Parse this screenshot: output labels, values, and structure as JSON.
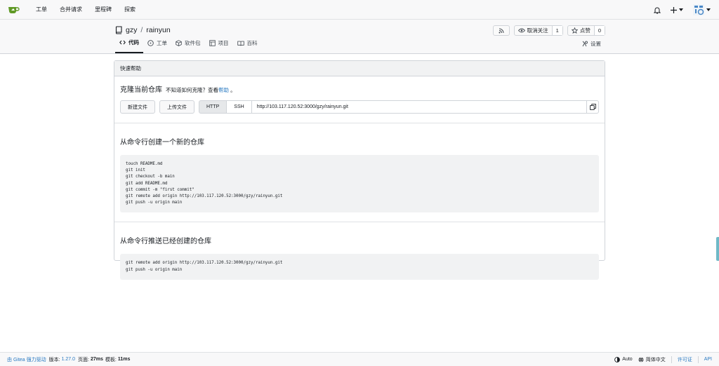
{
  "nav": {
    "links": [
      "工单",
      "合并请求",
      "里程碑",
      "探索"
    ]
  },
  "repo": {
    "owner": "gzy",
    "separator": "/",
    "name": "rainyun",
    "watch_label": "取消关注",
    "watch_count": "1",
    "star_label": "点赞",
    "star_count": "0",
    "tabs": [
      "代码",
      "工单",
      "软件包",
      "项目",
      "百科"
    ],
    "settings_label": "设置"
  },
  "panel": {
    "header": "快速帮助",
    "clone_title": "克隆当前仓库",
    "clone_hint": "不知道如何克隆？查看",
    "clone_help_link": "帮助",
    "clone_hint_end": "。",
    "new_file_button": "新建文件",
    "upload_file_button": "上传文件",
    "http_label": "HTTP",
    "ssh_label": "SSH",
    "clone_url": "http://103.117.120.52:3000/gzy/rainyun.git",
    "create_title": "从命令行创建一个新的仓库",
    "create_code": "touch README.md\ngit init\ngit checkout -b main\ngit add README.md\ngit commit -m \"first commit\"\ngit remote add origin http://103.117.120.52:3000/gzy/rainyun.git\ngit push -u origin main",
    "push_title": "从命令行推送已经创建的仓库",
    "push_code": "git remote add origin http://103.117.120.52:3000/gzy/rainyun.git\ngit push -u origin main"
  },
  "footer": {
    "powered": "由 Gitea 强力驱动",
    "version_label": "版本:",
    "version": "1.27.0",
    "page_label": "页面:",
    "page_time": "27ms",
    "template_label": "模板:",
    "template_time": "11ms",
    "theme": "Auto",
    "language": "简体中文",
    "license": "许可证",
    "api": "API"
  },
  "colors": {
    "link": "#2a7ac2",
    "logo_green": "#609926"
  }
}
